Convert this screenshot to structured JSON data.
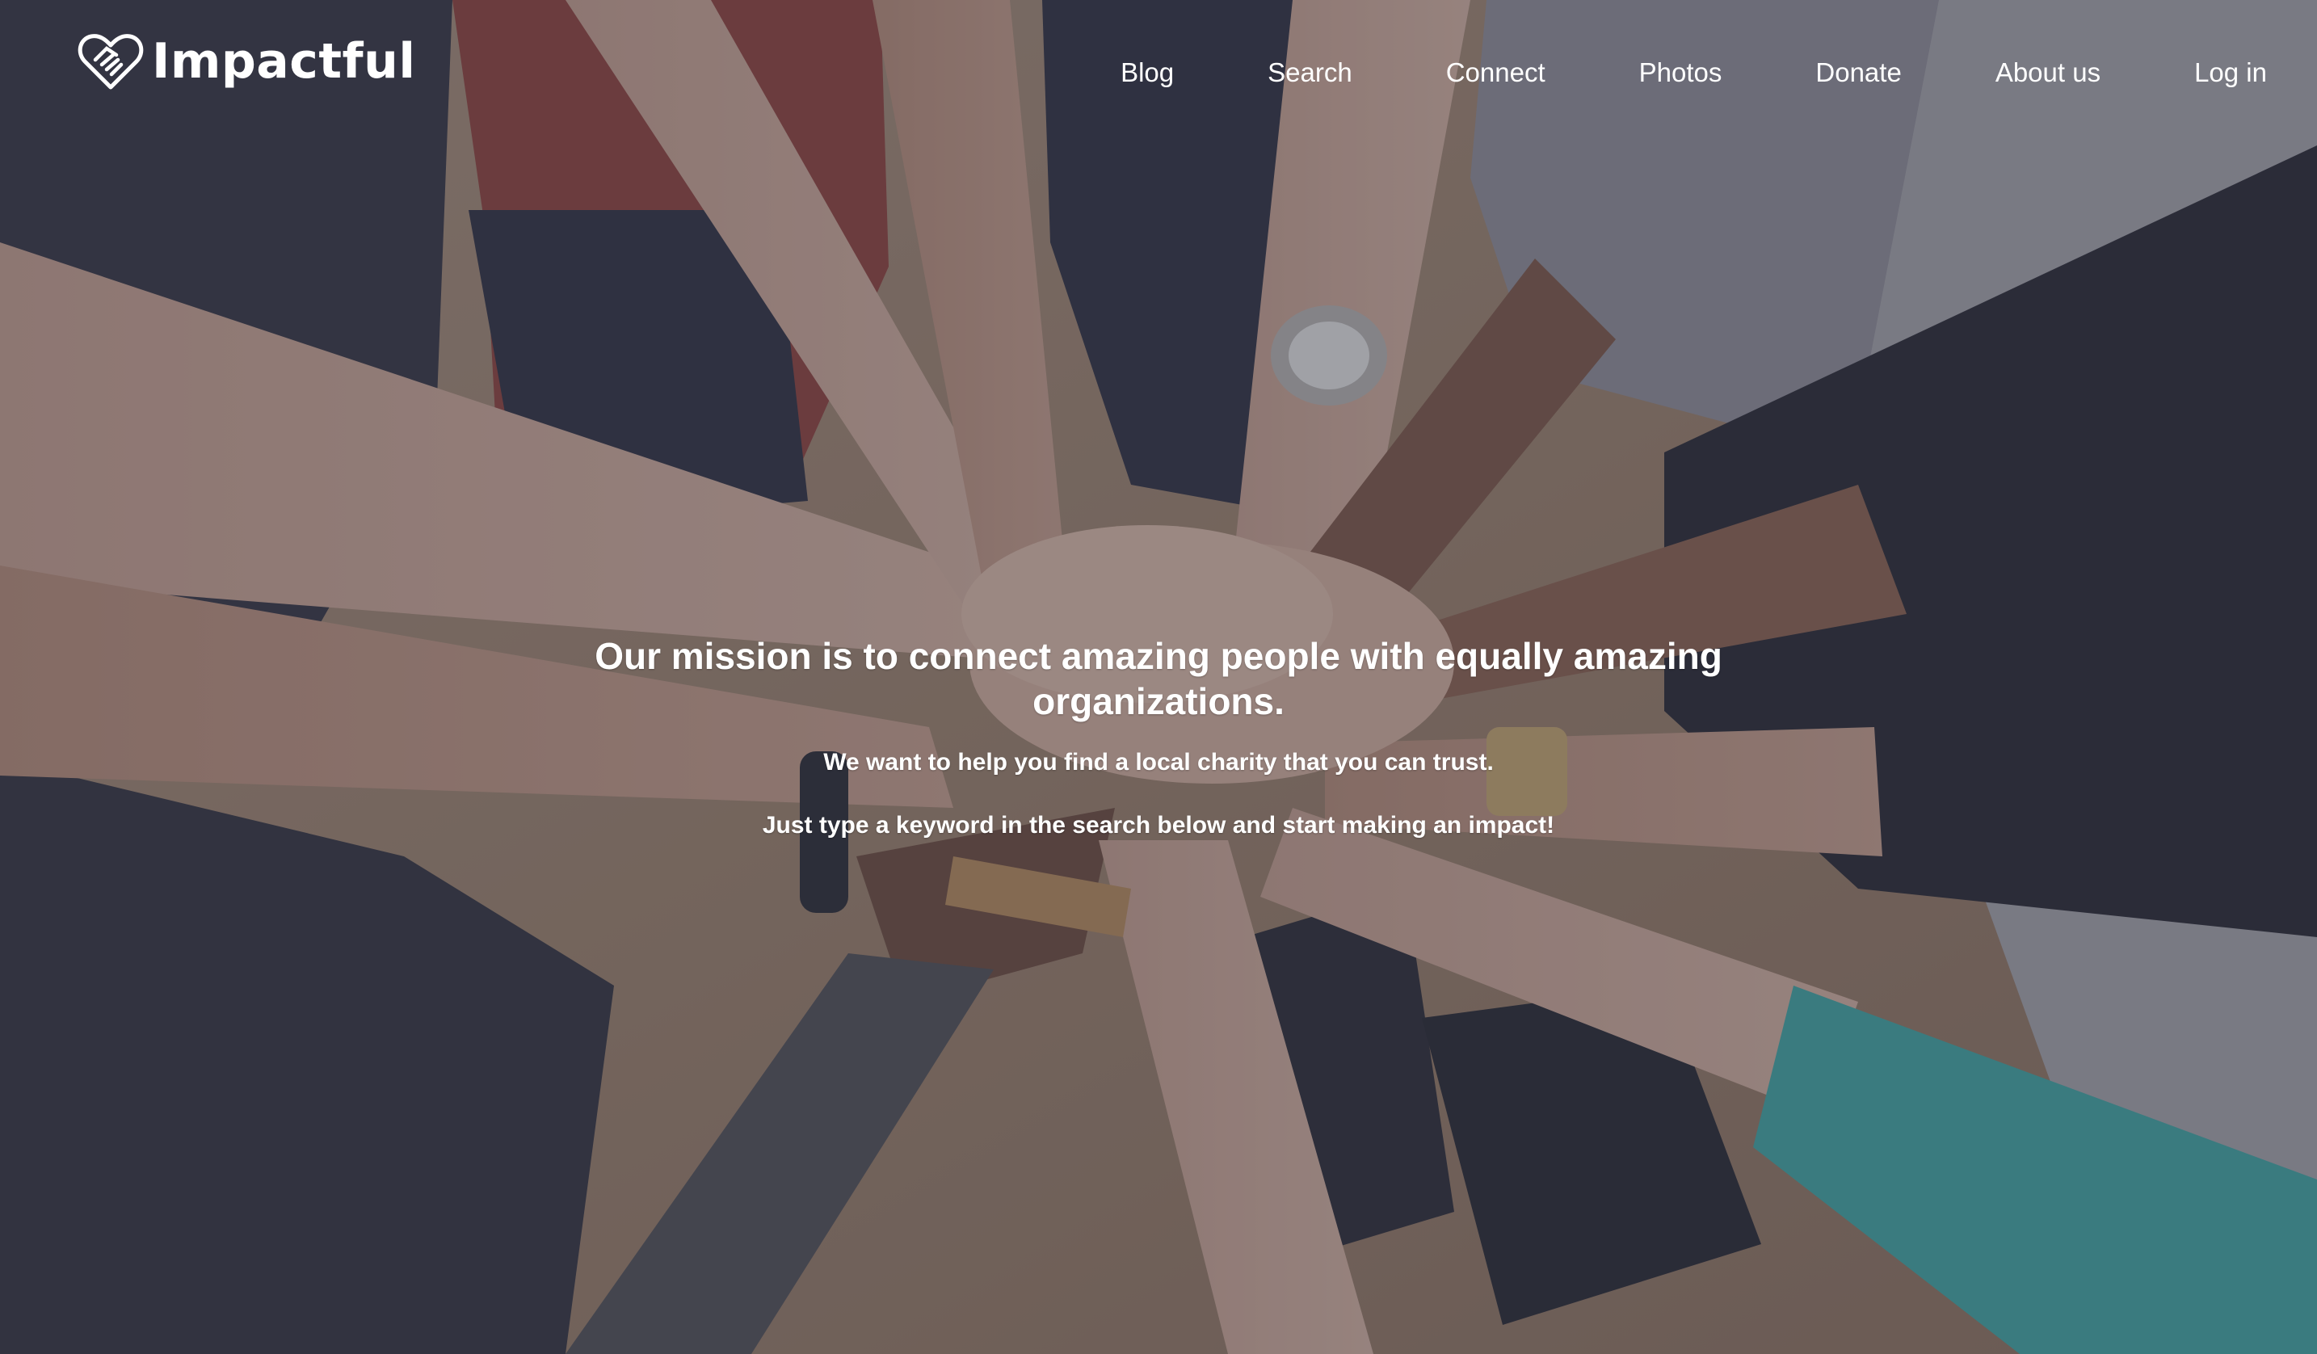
{
  "brand": {
    "name": "Impactful",
    "icon": "handshake-heart-icon"
  },
  "nav": {
    "items": [
      {
        "label": "Blog"
      },
      {
        "label": "Search"
      },
      {
        "label": "Connect"
      },
      {
        "label": "Photos"
      },
      {
        "label": "Donate"
      },
      {
        "label": "About us"
      },
      {
        "label": "Log in"
      }
    ]
  },
  "hero": {
    "headline": "Our mission is to connect amazing people with equally amazing organizations.",
    "subline_1": "We want to help you find a local charity that you can trust.",
    "subline_2": "Just type a keyword in the search below and start making an impact!",
    "background": "stacked-hands-photo"
  },
  "colors": {
    "text": "#ffffff",
    "overlay": "#3c3e4e"
  }
}
